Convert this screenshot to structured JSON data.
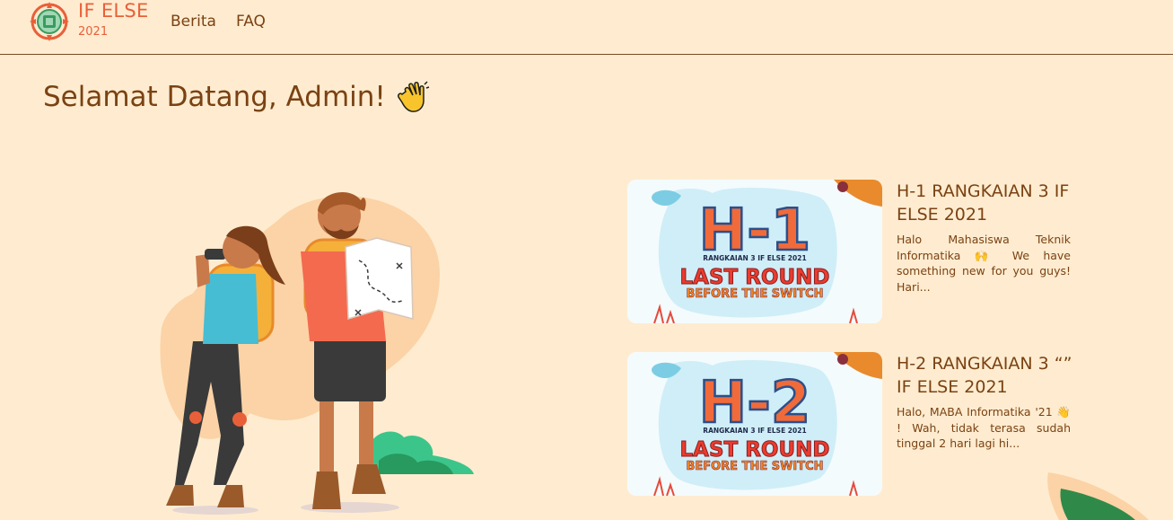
{
  "brand": {
    "name": "IF ELSE",
    "year": "2021",
    "logo_icon": "compass-chip-logo-icon"
  },
  "nav": {
    "items": [
      {
        "label": "Berita"
      },
      {
        "label": "FAQ"
      }
    ]
  },
  "welcome": {
    "text": "Selamat Datang, Admin!",
    "emoji_icon": "waving-hand-icon"
  },
  "illustration": {
    "icon": "hikers-with-map-illustration"
  },
  "news": [
    {
      "title": "H-1 RANGKAIAN 3 IF ELSE 2021",
      "excerpt": "Halo Mahasiswa Teknik Informatika 🙌 We have something new for you guys! Hari...",
      "thumb": {
        "countdown": "H-1",
        "subtitle": "RANGKAIAN 3 IF ELSE 2021",
        "headline_1": "LAST ROUND",
        "headline_2": "BEFORE THE SWITCH"
      }
    },
    {
      "title": "H-2 RANGKAIAN 3 “” IF ELSE 2021",
      "excerpt": "Halo, MABA Informatika '21 👋 ! Wah, tidak terasa sudah tinggal 2 hari lagi hi...",
      "thumb": {
        "countdown": "H-2",
        "subtitle": "RANGKAIAN 3 IF ELSE 2021",
        "headline_1": "LAST ROUND",
        "headline_2": "BEFORE THE SWITCH"
      }
    }
  ],
  "colors": {
    "background": "#ffecd0",
    "brand_accent": "#e8603a",
    "text_brown": "#7a4213"
  }
}
